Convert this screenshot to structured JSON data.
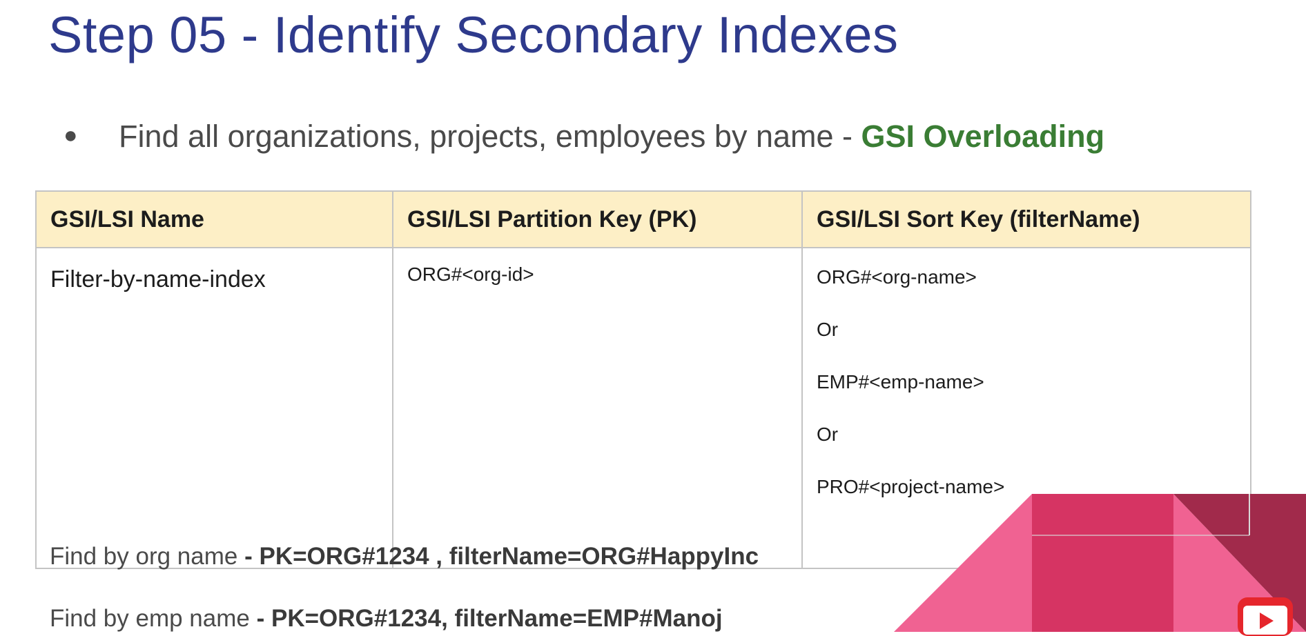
{
  "title": "Step 05 - Identify Secondary Indexes",
  "bullet": {
    "symbol": "●",
    "text": "Find all organizations, projects, employees by name - ",
    "highlight": "GSI Overloading"
  },
  "table": {
    "headers": [
      "GSI/LSI Name",
      "GSI/LSI Partition Key (PK)",
      "GSI/LSI Sort Key (filterName)"
    ],
    "row": {
      "name": "Filter-by-name-index",
      "pk": "ORG#<org-id>",
      "sort_key_lines": [
        "ORG#<org-name>",
        "Or",
        "EMP#<emp-name>",
        "Or",
        "PRO#<project-name>"
      ]
    }
  },
  "notes": [
    {
      "label": "Find by org name ",
      "value": "- PK=ORG#1234 , filterName=ORG#HappyInc"
    },
    {
      "label": "Find by emp name ",
      "value": "- PK=ORG#1234, filterName=EMP#Manoj"
    }
  ],
  "colors": {
    "title": "#2e3a8c",
    "highlight": "#3a7d34",
    "header_bg": "#fdefc6",
    "deco_pink": "#f06292",
    "deco_magenta": "#d63463",
    "deco_maroon": "#a12a4b"
  },
  "icons": [
    "youtube-play-icon"
  ]
}
